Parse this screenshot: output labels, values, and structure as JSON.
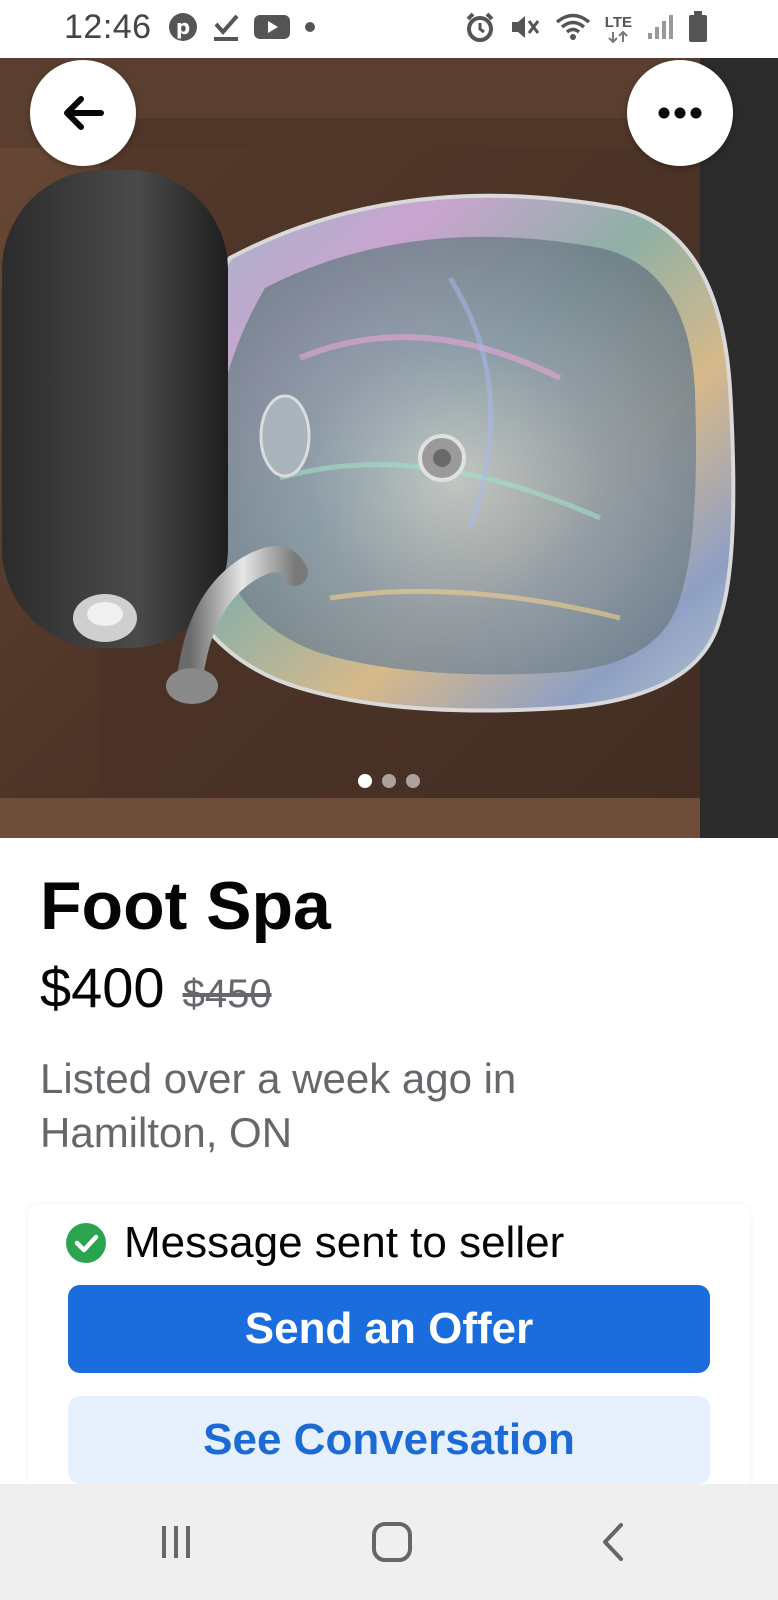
{
  "status_bar": {
    "time": "12:46",
    "left_icons": [
      "pinterest-icon",
      "checkmark-download-icon",
      "youtube-icon",
      "dot-icon"
    ],
    "right_icons": [
      "alarm-icon",
      "mute-icon",
      "wifi-icon",
      "lte-icon",
      "signal-icon",
      "battery-icon"
    ],
    "network_label": "LTE"
  },
  "hero": {
    "photo_description_icon": "foot-spa-photo",
    "carousel": {
      "count": 3,
      "active": 0
    }
  },
  "listing": {
    "title": "Foot Spa",
    "price": "$400",
    "original_price": "$450",
    "listed_text": "Listed over a week ago in Hamilton, ON"
  },
  "actions": {
    "status_message": "Message sent to seller",
    "primary_button": "Send an Offer",
    "secondary_button": "See Conversation"
  },
  "colors": {
    "primary_blue": "#1b6ddd",
    "secondary_bg": "#e7f1fd",
    "secondary_text": "#1c6ad6",
    "success_green": "#2aa44f",
    "muted_text": "#65676b"
  },
  "nav_bar": {
    "buttons": [
      "recent-apps-icon",
      "home-icon",
      "back-icon"
    ]
  }
}
